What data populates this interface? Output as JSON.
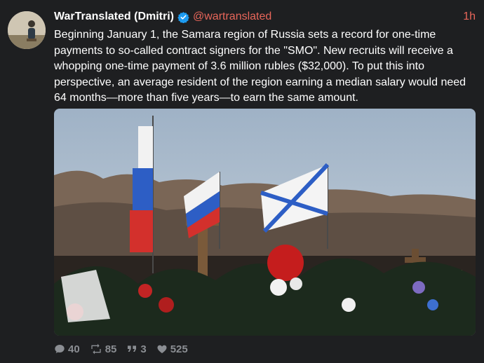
{
  "tweet": {
    "display_name": "WarTranslated (Dmitri)",
    "handle": "@wartranslated",
    "time": "1h",
    "text": "Beginning January 1, the Samara region of Russia sets a record for one-time payments to so-called contract signers for the \"SMO\". New recruits will receive a whopping one-time payment of 3.6 million rubles ($32,000). To put this into perspective, an average resident of the region earning a median salary would need 64 months—more than five years—to earn the same amount."
  },
  "media": {
    "icons": {
      "verified": "verified-badge-icon"
    }
  },
  "actions": {
    "replies": "40",
    "retweets": "85",
    "quotes": "3",
    "likes": "525"
  },
  "colors": {
    "accent": "#e8665a",
    "background": "#1e1f21",
    "muted": "#8b8e93",
    "verified": "#1d9bf0"
  }
}
